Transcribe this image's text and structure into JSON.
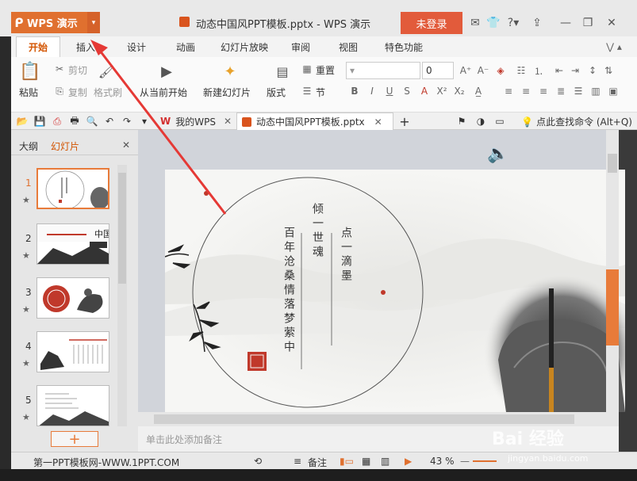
{
  "app": {
    "menu_button": "WPS 演示",
    "doc_title": "动态中国风PPT模板.pptx - WPS 演示",
    "login": "未登录"
  },
  "ribbon_tabs": [
    "开始",
    "插入",
    "设计",
    "动画",
    "幻灯片放映",
    "审阅",
    "视图",
    "特色功能"
  ],
  "ribbon": {
    "paste": "粘贴",
    "cut": "剪切",
    "copy": "复制",
    "format_painter": "格式刷",
    "from_current": "从当前开始",
    "new_slide": "新建幻灯片",
    "layout": "版式",
    "reset": "重置",
    "section": "节",
    "font_size": "0"
  },
  "doc_tabs": {
    "my_wps": "我的WPS",
    "current": "动态中国风PPT模板.pptx",
    "find_cmd": "点此查找命令 (Alt+Q)"
  },
  "left_pane": {
    "tab_outline": "大纲",
    "tab_slides": "幻灯片",
    "slides": [
      {
        "num": "1"
      },
      {
        "num": "2"
      },
      {
        "num": "3"
      },
      {
        "num": "4"
      },
      {
        "num": "5"
      }
    ],
    "add": "+"
  },
  "slide_text": {
    "col1": "点一滴墨",
    "col2": "倾一世魂",
    "col3": "百年沧桑情落梦萦中",
    "thumb2_title": "中国"
  },
  "notes_placeholder": "单击此处添加备注",
  "status": {
    "left": "第一PPT模板网-WWW.1PPT.COM",
    "notes": "备注",
    "zoom": "43 %"
  },
  "watermark": {
    "brand": "Bai  经验",
    "url": "jingyan.baidu.com"
  },
  "colors": {
    "accent": "#e0702f",
    "login": "#e25b3b",
    "arrow": "#e53935"
  }
}
